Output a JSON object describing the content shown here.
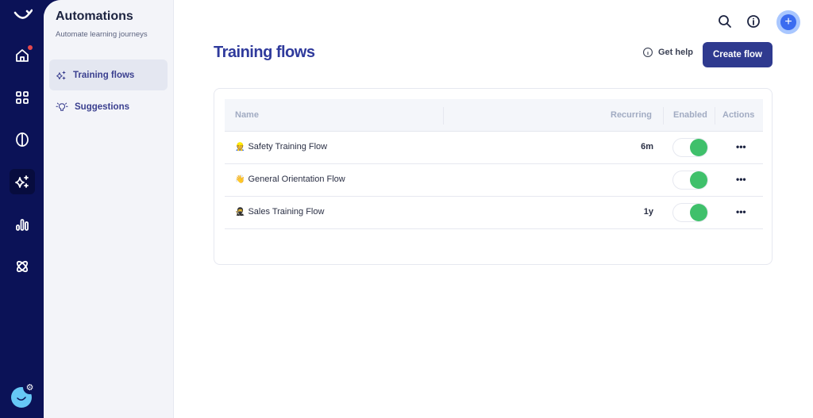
{
  "rail": {
    "items": [
      {
        "name": "logo",
        "active": false
      },
      {
        "name": "home",
        "active": false,
        "notification": true
      },
      {
        "name": "apps",
        "active": false
      },
      {
        "name": "brain",
        "active": false
      },
      {
        "name": "automations",
        "active": true
      },
      {
        "name": "analytics",
        "active": false
      },
      {
        "name": "integrations",
        "active": false
      }
    ],
    "settings_glyph": "⚙"
  },
  "sidebar": {
    "title": "Automations",
    "subtitle": "Automate learning journeys",
    "items": [
      {
        "label": "Training flows",
        "icon": "sparkles-icon",
        "active": true
      },
      {
        "label": "Suggestions",
        "icon": "lightbulb-icon",
        "active": false
      }
    ]
  },
  "header": {
    "plus_glyph": "+"
  },
  "page": {
    "title": "Training flows",
    "help_label": "Get help",
    "create_label": "Create flow"
  },
  "table": {
    "columns": [
      "Name",
      "Recurring",
      "Enabled",
      "Actions"
    ],
    "rows": [
      {
        "emoji": "👷",
        "name": "Safety Training Flow",
        "recurring": "6m",
        "enabled": true
      },
      {
        "emoji": "👋",
        "name": "General Orientation Flow",
        "recurring": "",
        "enabled": true
      },
      {
        "emoji": "🥷",
        "name": "Sales Training Flow",
        "recurring": "1y",
        "enabled": true
      }
    ],
    "actions_glyph": "•••"
  },
  "colors": {
    "rail": "#0b1257",
    "accent": "#2f3a8f",
    "toggle_on": "#3fc06b",
    "plus_button": "#3b6cf0"
  }
}
